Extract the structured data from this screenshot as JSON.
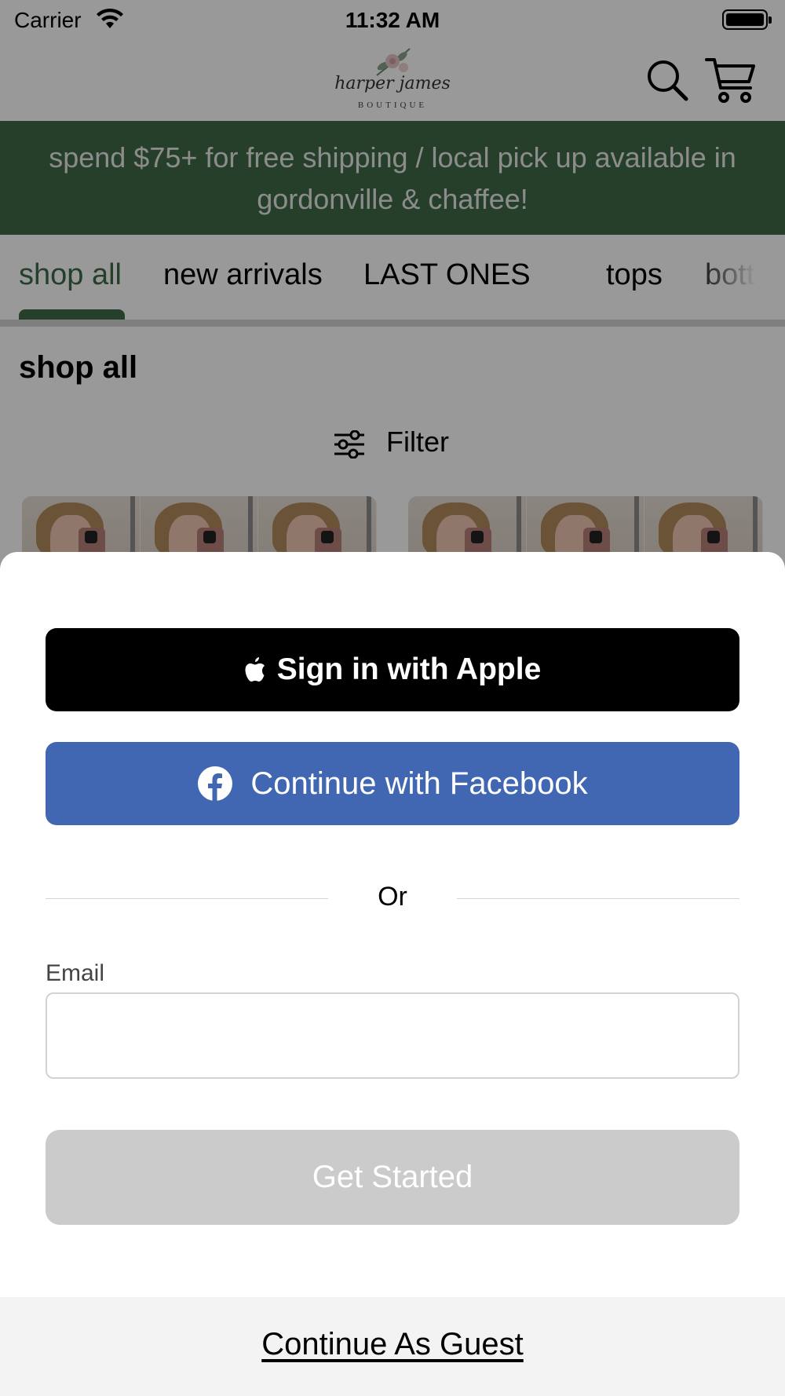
{
  "status_bar": {
    "carrier": "Carrier",
    "time": "11:32 AM",
    "wifi_icon": "wifi-icon",
    "battery_icon": "battery-full-icon"
  },
  "header": {
    "logo_script": "harper james",
    "logo_sub": "BOUTIQUE",
    "search_icon": "search-icon",
    "cart_icon": "cart-icon"
  },
  "banner": {
    "text": "spend $75+ for free shipping / local pick up available in gordonville & chaffee!",
    "background": "#3e6a47"
  },
  "category_tabs": [
    {
      "label": "shop all",
      "active": true
    },
    {
      "label": "new arrivals",
      "active": false
    },
    {
      "label": "LAST ONES",
      "active": false
    },
    {
      "label": "tops",
      "active": false
    },
    {
      "label": "bott",
      "active": false
    }
  ],
  "page": {
    "title": "shop all",
    "filter_label": "Filter",
    "filter_icon": "sliders-icon"
  },
  "sheet": {
    "apple_button": "Sign in with Apple",
    "apple_icon": "apple-icon",
    "facebook_button": "Continue with Facebook",
    "facebook_icon": "facebook-icon",
    "facebook_color": "#4267b2",
    "divider_text": "Or",
    "email_label": "Email",
    "email_value": "",
    "get_started_button": "Get Started",
    "guest_link": "Continue As Guest"
  }
}
